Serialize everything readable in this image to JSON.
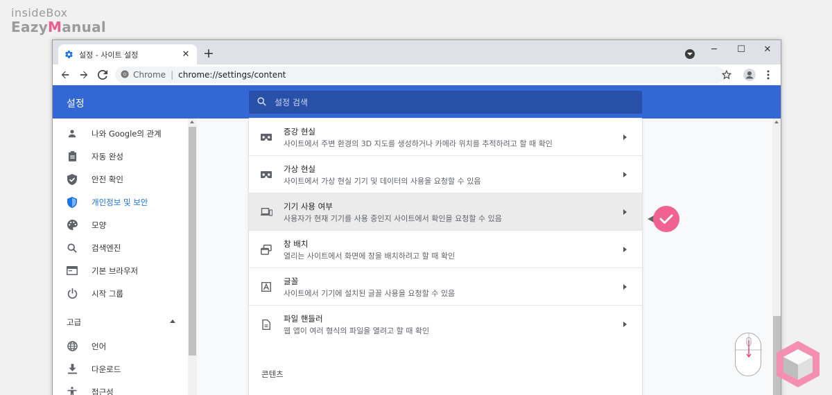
{
  "watermark": {
    "line1": "insideBox",
    "line2_a": "Eazy",
    "line2_b": "M",
    "line2_c": "anual"
  },
  "tab": {
    "title": "설정 - 사이트 설정",
    "close": "✕",
    "new_tab": "+"
  },
  "window_controls": {
    "minimize": "─",
    "maximize": "☐",
    "close": "✕"
  },
  "address": {
    "site": "Chrome",
    "separator": "|",
    "url": "chrome://settings/content"
  },
  "header": {
    "title": "설정",
    "search_placeholder": "설정 검색"
  },
  "sidebar": {
    "items": [
      {
        "label": "나와 Google의 관계",
        "icon": "person-icon"
      },
      {
        "label": "자동 완성",
        "icon": "clipboard-icon"
      },
      {
        "label": "안전 확인",
        "icon": "shield-check-icon"
      },
      {
        "label": "개인정보 및 보안",
        "icon": "shield-icon",
        "active": true
      },
      {
        "label": "모양",
        "icon": "palette-icon"
      },
      {
        "label": "검색엔진",
        "icon": "search-icon"
      },
      {
        "label": "기본 브라우저",
        "icon": "browser-icon"
      },
      {
        "label": "시작 그룹",
        "icon": "power-icon"
      }
    ],
    "advanced_label": "고급",
    "advanced_items": [
      {
        "label": "언어",
        "icon": "globe-icon"
      },
      {
        "label": "다운로드",
        "icon": "download-icon"
      },
      {
        "label": "접근성",
        "icon": "accessibility-icon"
      }
    ]
  },
  "rows": [
    {
      "title": "증강 현실",
      "subtitle": "사이트에서 주변 환경의 3D 지도를 생성하거나 카메라 위치를 추적하려고 할 때 확인",
      "icon": "vr-headset-icon"
    },
    {
      "title": "가상 현실",
      "subtitle": "사이트에서 가상 현실 기기 및 데이터의 사용을 요청할 수 있음",
      "icon": "vr-headset-icon"
    },
    {
      "title": "기기 사용 여부",
      "subtitle": "사용자가 현재 기기를 사용 중인지 사이트에서 확인을 요청할 수 있음",
      "icon": "devices-icon",
      "highlighted": true
    },
    {
      "title": "창 배치",
      "subtitle": "열리는 사이트에서 화면에 창을 배치하려고 할 때 확인",
      "icon": "window-placement-icon"
    },
    {
      "title": "글꼴",
      "subtitle": "사이트에서 기기에 설치된 글꼴 사용을 요청할 수 있음",
      "icon": "font-icon"
    },
    {
      "title": "파일 핸들러",
      "subtitle": "웹 앱이 여러 형식의 파일을 열려고 할 때 확인",
      "icon": "file-icon"
    }
  ],
  "section_label": "콘텐츠",
  "colors": {
    "header_bg": "#3367d6",
    "search_bg": "#2850a8",
    "active": "#1a73e8",
    "check_pink": "#f06292",
    "row_highlight": "#ebebeb"
  }
}
